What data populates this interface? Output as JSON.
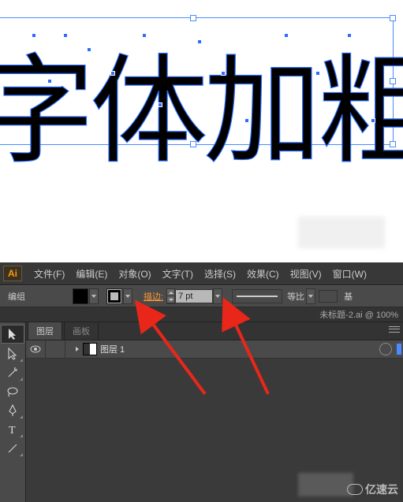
{
  "canvas": {
    "text": "字体加粗"
  },
  "menubar": {
    "logo": "Ai",
    "items": [
      "文件(F)",
      "编辑(E)",
      "对象(O)",
      "文字(T)",
      "选择(S)",
      "效果(C)",
      "视图(V)",
      "窗口(W)"
    ]
  },
  "controlbar": {
    "selection_label": "编组",
    "stroke_label": "描边:",
    "stroke_value": "7 pt",
    "ratio_label": "等比",
    "basic_label": "基"
  },
  "docbar": {
    "title": "未标题-2.ai @ 100%"
  },
  "panel": {
    "tabs": [
      "图层",
      "画板"
    ],
    "layer_name": "图层 1"
  },
  "watermark": "亿速云"
}
